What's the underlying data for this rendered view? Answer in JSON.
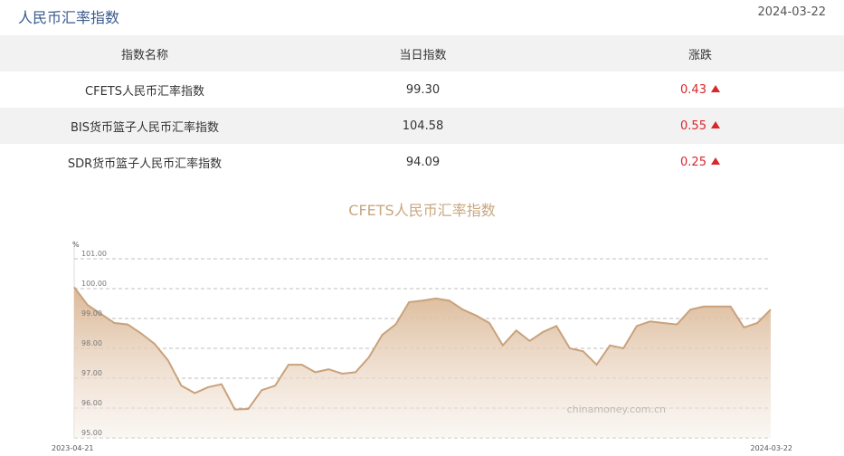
{
  "header": {
    "title": "人民币汇率指数",
    "date": "2024-03-22"
  },
  "table": {
    "headers": [
      "指数名称",
      "当日指数",
      "涨跌"
    ],
    "rows": [
      {
        "name": "CFETS人民币汇率指数",
        "value": "99.30",
        "change": "0.43"
      },
      {
        "name": "BIS货币篮子人民币汇率指数",
        "value": "104.58",
        "change": "0.55"
      },
      {
        "name": "SDR货币篮子人民币汇率指数",
        "value": "94.09",
        "change": "0.25"
      }
    ]
  },
  "colors": {
    "accent": "#c8a780",
    "up": "#d8272a",
    "line": "#c9a27c"
  },
  "chart_data": {
    "type": "area",
    "title": "CFETS人民币汇率指数",
    "ylabel": "%",
    "ylim": [
      95.0,
      101.0
    ],
    "yticks": [
      "101.00",
      "100.00",
      "99.00",
      "98.00",
      "97.00",
      "96.00",
      "95.00"
    ],
    "x_start_label": "2023-04-21",
    "x_end_label": "2024-03-22",
    "watermark": "chinamoney.com.cn",
    "grid": true,
    "values": [
      100.05,
      99.45,
      99.15,
      98.85,
      98.8,
      98.5,
      98.15,
      97.6,
      96.75,
      96.5,
      96.7,
      96.8,
      95.95,
      95.97,
      96.6,
      96.75,
      97.45,
      97.45,
      97.2,
      97.3,
      97.15,
      97.2,
      97.7,
      98.45,
      98.8,
      99.55,
      99.6,
      99.67,
      99.6,
      99.3,
      99.1,
      98.85,
      98.1,
      98.6,
      98.25,
      98.55,
      98.75,
      98.0,
      97.9,
      97.45,
      98.1,
      98.0,
      98.75,
      98.9,
      98.85,
      98.8,
      99.3,
      99.4,
      99.4,
      99.4,
      98.7,
      98.85,
      99.3
    ]
  }
}
